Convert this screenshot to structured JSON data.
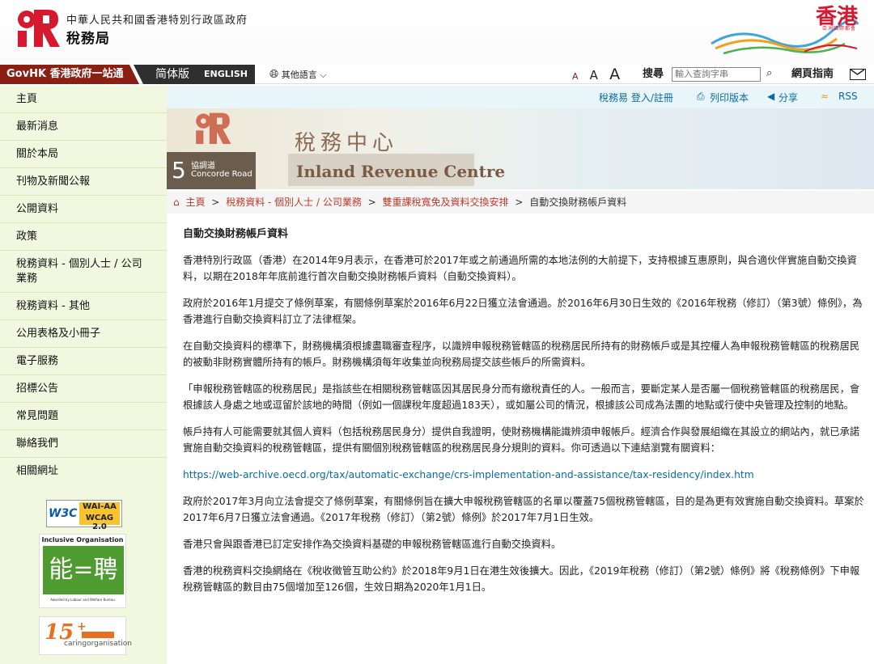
{
  "header": {
    "org_line1": "中華人民共和國香港特別行政區政府",
    "org_line2": "稅務局",
    "brand_text": "香港",
    "brand_sub": "亞洲國際都會"
  },
  "topbar": {
    "govhk": "GovHK 香港政府一站通",
    "simplified": "简体版",
    "english": "ENGLISH",
    "other_languages": "其他語言",
    "font_small": "A",
    "font_medium": "A",
    "font_large": "A",
    "search_label": "搜尋",
    "search_placeholder": "輸入查詢字串",
    "guide": "網頁指南"
  },
  "sidebar": {
    "items": [
      "主頁",
      "最新消息",
      "關於本局",
      "刊物及新聞公報",
      "公開資料",
      "政策",
      "稅務資料 - 個別人士 / 公司業務",
      "稅務資料 - 其他",
      "公用表格及小冊子",
      "電子服務",
      "招標公告",
      "常見問題",
      "聯絡我們",
      "相關網址"
    ],
    "wcag_w3c": "W3C",
    "wcag_line1": "WAI-AA",
    "wcag_line2": "WCAG 2.0",
    "inclusive_title": "Inclusive Organisation",
    "inclusive_art": "能=聘",
    "inclusive_foot": "Awarded by Labour and Welfare Bureau",
    "caring_num": "15",
    "caring_text": "caringorganisation"
  },
  "toolbar": {
    "etax": "稅務易 登入/註冊",
    "print": "列印版本",
    "share": "分享",
    "rss": "RSS"
  },
  "banner": {
    "road_num": "5",
    "road_cn": "協調道",
    "road_en": "Concorde Road",
    "centre_cn": "稅務中心",
    "centre_en": "Inland Revenue Centre"
  },
  "breadcrumb": {
    "home": "主頁",
    "crumb1": "稅務資料 - 個別人士 / 公司業務",
    "crumb2": "雙重課稅寬免及資料交換安排",
    "current": "自動交換財務帳戶資料",
    "sep": ">"
  },
  "content": {
    "title": "自動交換財務帳戶資料",
    "p1": "香港特別行政區（香港）在2014年9月表示，在香港可於2017年或之前通過所需的本地法例的大前提下，支持根據互惠原則，與合適伙伴實施自動交換資料，以期在2018年年底前進行首次自動交換財務帳戶資料（自動交換資料）。",
    "p2": "政府於2016年1月提交了條例草案，有關條例草案於2016年6月22日獲立法會通過。於2016年6月30日生效的《2016年稅務（修訂）（第3號）條例》，為香港進行自動交換資料訂立了法律框架。",
    "p3": "在自動交換資料的標準下，財務機構須根據盡職審查程序，以識辨申報稅務管轄區的稅務居民所持有的財務帳戶或是其控權人為申報稅務管轄區的稅務居民的被動非財務實體所持有的帳戶。財務機構須每年收集並向稅務局提交該些帳戶的所需資料。",
    "p4": "「申報稅務管轄區的稅務居民」是指該些在相關稅務管轄區因其居民身分而有繳稅責任的人。一般而言，要斷定某人是否屬一個稅務管轄區的稅務居民，會根據該人身處之地或逗留於該地的時間（例如一個課稅年度超過183天），或如屬公司的情況，根據該公司成為法團的地點或行使中央管理及控制的地點。",
    "p5": "帳戶持有人可能需要就其個人資料（包括稅務居民身分）提供自我證明，使財務機構能識辨須申報帳戶。經濟合作與發展組織在其設立的網站內，就已承諾實施自動交換資料的稅務管轄區，提供有關個別稅務管轄區的稅務居民身分規則的資料。你可透過以下連結瀏覽有關資料：",
    "link": "https://web-archive.oecd.org/tax/automatic-exchange/crs-implementation-and-assistance/tax-residency/index.htm",
    "p6": "政府於2017年3月向立法會提交了條例草案，有關條例旨在擴大申報稅務管轄區的名單以覆蓋75個稅務管轄區，目的是為更有效實施自動交換資料。草案於2017年6月7日獲立法會通過。《2017年稅務（修訂）（第2號）條例》於2017年7月1日生效。",
    "p7": "香港只會與跟香港已訂定安排作為交換資料基礎的申報稅務管轄區進行自動交換資料。",
    "p8": "香港的稅務資料交換網絡在《稅收徵管互助公約》於2018年9月1日在港生效後擴大。因此，《2019年稅務（修訂）（第2號）條例》將《稅務條例》下申報稅務管轄區的數目由75個增加至126個，生效日期為2020年1月1日。"
  },
  "colors": {
    "brand_red": "#8a1f14",
    "link_blue": "#0b6aa6",
    "sidebar_bg": "#f2f8df"
  }
}
